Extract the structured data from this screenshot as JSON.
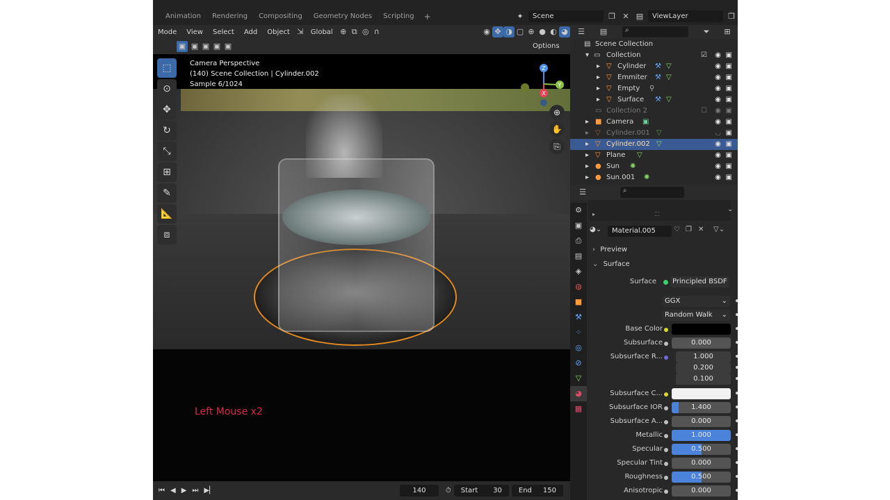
{
  "topbar": {
    "tabs": [
      "Animation",
      "Rendering",
      "Compositing",
      "Geometry Nodes",
      "Scripting"
    ],
    "add_tab": "+",
    "scene": "Scene",
    "view_layer": "ViewLayer"
  },
  "viewport_header": {
    "mode": "Mode",
    "menus": [
      "View",
      "Select",
      "Add",
      "Object"
    ],
    "orientation": "Global",
    "options": "Options"
  },
  "viewport": {
    "info_line1": "Camera Perspective",
    "info_line2": "(140) Scene Collection | Cylinder.002",
    "info_line3": "Sample 6/1024",
    "gizmo_z": "Z",
    "gizmo_y": "Y",
    "gizmo_x": "X"
  },
  "overlay_text": "Left Mouse x2",
  "timeline": {
    "current_frame": "140",
    "start_label": "Start",
    "start": "30",
    "end_label": "End",
    "end": "150"
  },
  "outliner": {
    "rows": [
      {
        "label": "Scene Collection"
      },
      {
        "label": "Collection"
      },
      {
        "label": "Cylinder"
      },
      {
        "label": "Emmiter"
      },
      {
        "label": "Empty"
      },
      {
        "label": "Surface"
      },
      {
        "label": "Collection 2"
      },
      {
        "label": "Camera"
      },
      {
        "label": "Cylinder.001"
      },
      {
        "label": "Cylinder.002"
      },
      {
        "label": "Plane"
      },
      {
        "label": "Sun"
      },
      {
        "label": "Sun.001"
      }
    ]
  },
  "properties": {
    "material_name": "Material.005",
    "sections": {
      "preview": "Preview",
      "surface": "Surface"
    },
    "surface_label": "Surface",
    "surface_shader": "Principled BSDF",
    "distribution": "GGX",
    "subsurface_method": "Random Walk",
    "fields": [
      {
        "label": "Base Color",
        "value": "",
        "fill": 0
      },
      {
        "label": "Subsurface",
        "value": "0.000",
        "fill": 0
      },
      {
        "label": "Subsurface R...",
        "value": "1.000",
        "fill": 0
      },
      {
        "label": "",
        "value": "0.200",
        "fill": 0
      },
      {
        "label": "",
        "value": "0.100",
        "fill": 0
      },
      {
        "label": "Subsurface C...",
        "value": "",
        "fill": 0
      },
      {
        "label": "Subsurface IOR",
        "value": "1.400",
        "fill": 0.12
      },
      {
        "label": "Subsurface A...",
        "value": "0.000",
        "fill": 0
      },
      {
        "label": "Metallic",
        "value": "1.000",
        "fill": 1.0
      },
      {
        "label": "Specular",
        "value": "0.500",
        "fill": 0.5
      },
      {
        "label": "Specular Tint",
        "value": "0.000",
        "fill": 0
      },
      {
        "label": "Roughness",
        "value": "0.500",
        "fill": 0.5
      },
      {
        "label": "Anisotropic",
        "value": "0.000",
        "fill": 0
      }
    ]
  },
  "colors": {
    "accent_blue": "#4a83d9",
    "selection": "#3a5a94",
    "outline_orange": "#e28a21",
    "overlay_red": "#d8284a"
  }
}
